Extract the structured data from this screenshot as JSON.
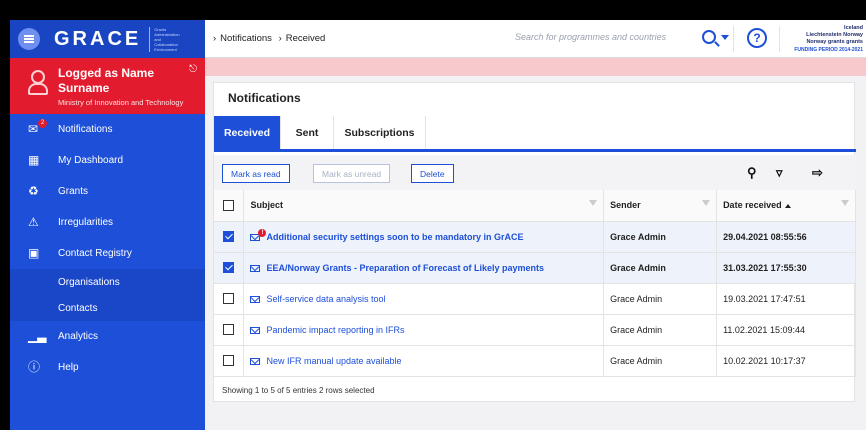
{
  "app": {
    "logo": "GRACE",
    "logo_sub": "Grants Administration and Collaboration Environment"
  },
  "user": {
    "logged_as": "Logged as Name",
    "surname": "Surname",
    "ministry": "Ministry of Innovation and Technology"
  },
  "sidebar": {
    "items": [
      {
        "label": "Notifications",
        "icon": "mail-icon",
        "badge": "2"
      },
      {
        "label": "My Dashboard",
        "icon": "dashboard-icon"
      },
      {
        "label": "Grants",
        "icon": "grants-icon"
      },
      {
        "label": "Irregularities",
        "icon": "warning-icon"
      },
      {
        "label": "Contact Registry",
        "icon": "contact-icon"
      }
    ],
    "subitems": [
      {
        "label": "Organisations"
      },
      {
        "label": "Contacts"
      }
    ],
    "bottom_items": [
      {
        "label": "Analytics",
        "icon": "analytics-icon"
      },
      {
        "label": "Help",
        "icon": "help-icon"
      }
    ]
  },
  "header": {
    "breadcrumb": [
      "Notifications",
      "Received"
    ],
    "search_placeholder": "Search for programmes and countries",
    "grants_logo": {
      "line1": "Iceland",
      "line2": "Liechtenstein Norway",
      "line3": "Norway grants grants",
      "period": "FUNDING PERIOD 2014-2021"
    }
  },
  "panel": {
    "title": "Notifications",
    "tabs": [
      "Received",
      "Sent",
      "Subscriptions"
    ],
    "active_tab": "Received",
    "toolbar": {
      "mark_read": "Mark as read",
      "mark_unread": "Mark as unread",
      "delete": "Delete"
    },
    "columns": [
      "Subject",
      "Sender",
      "Date received"
    ],
    "rows": [
      {
        "checked": true,
        "subject": "Additional security settings soon to be mandatory in GrACE",
        "sender": "Grace Admin",
        "date": "29.04.2021 08:55:56",
        "unread": true,
        "alert": "!"
      },
      {
        "checked": true,
        "subject": "EEA/Norway Grants - Preparation of Forecast of Likely payments",
        "sender": "Grace Admin",
        "date": "31.03.2021 17:55:30",
        "unread": true
      },
      {
        "checked": false,
        "subject": "Self-service data analysis tool",
        "sender": "Grace Admin",
        "date": "19.03.2021 17:47:51",
        "unread": false
      },
      {
        "checked": false,
        "subject": "Pandemic impact reporting in IFRs",
        "sender": "Grace Admin",
        "date": "11.02.2021 15:09:44",
        "unread": false
      },
      {
        "checked": false,
        "subject": "New IFR manual update available",
        "sender": "Grace Admin",
        "date": "10.02.2021 10:17:37",
        "unread": false
      }
    ],
    "footer": "Showing 1 to 5 of 5 entries   2 rows selected"
  },
  "colors": {
    "primary": "#1d4fd8",
    "accent_red": "#e21c2e",
    "alert_strip": "#f7c8cc"
  }
}
